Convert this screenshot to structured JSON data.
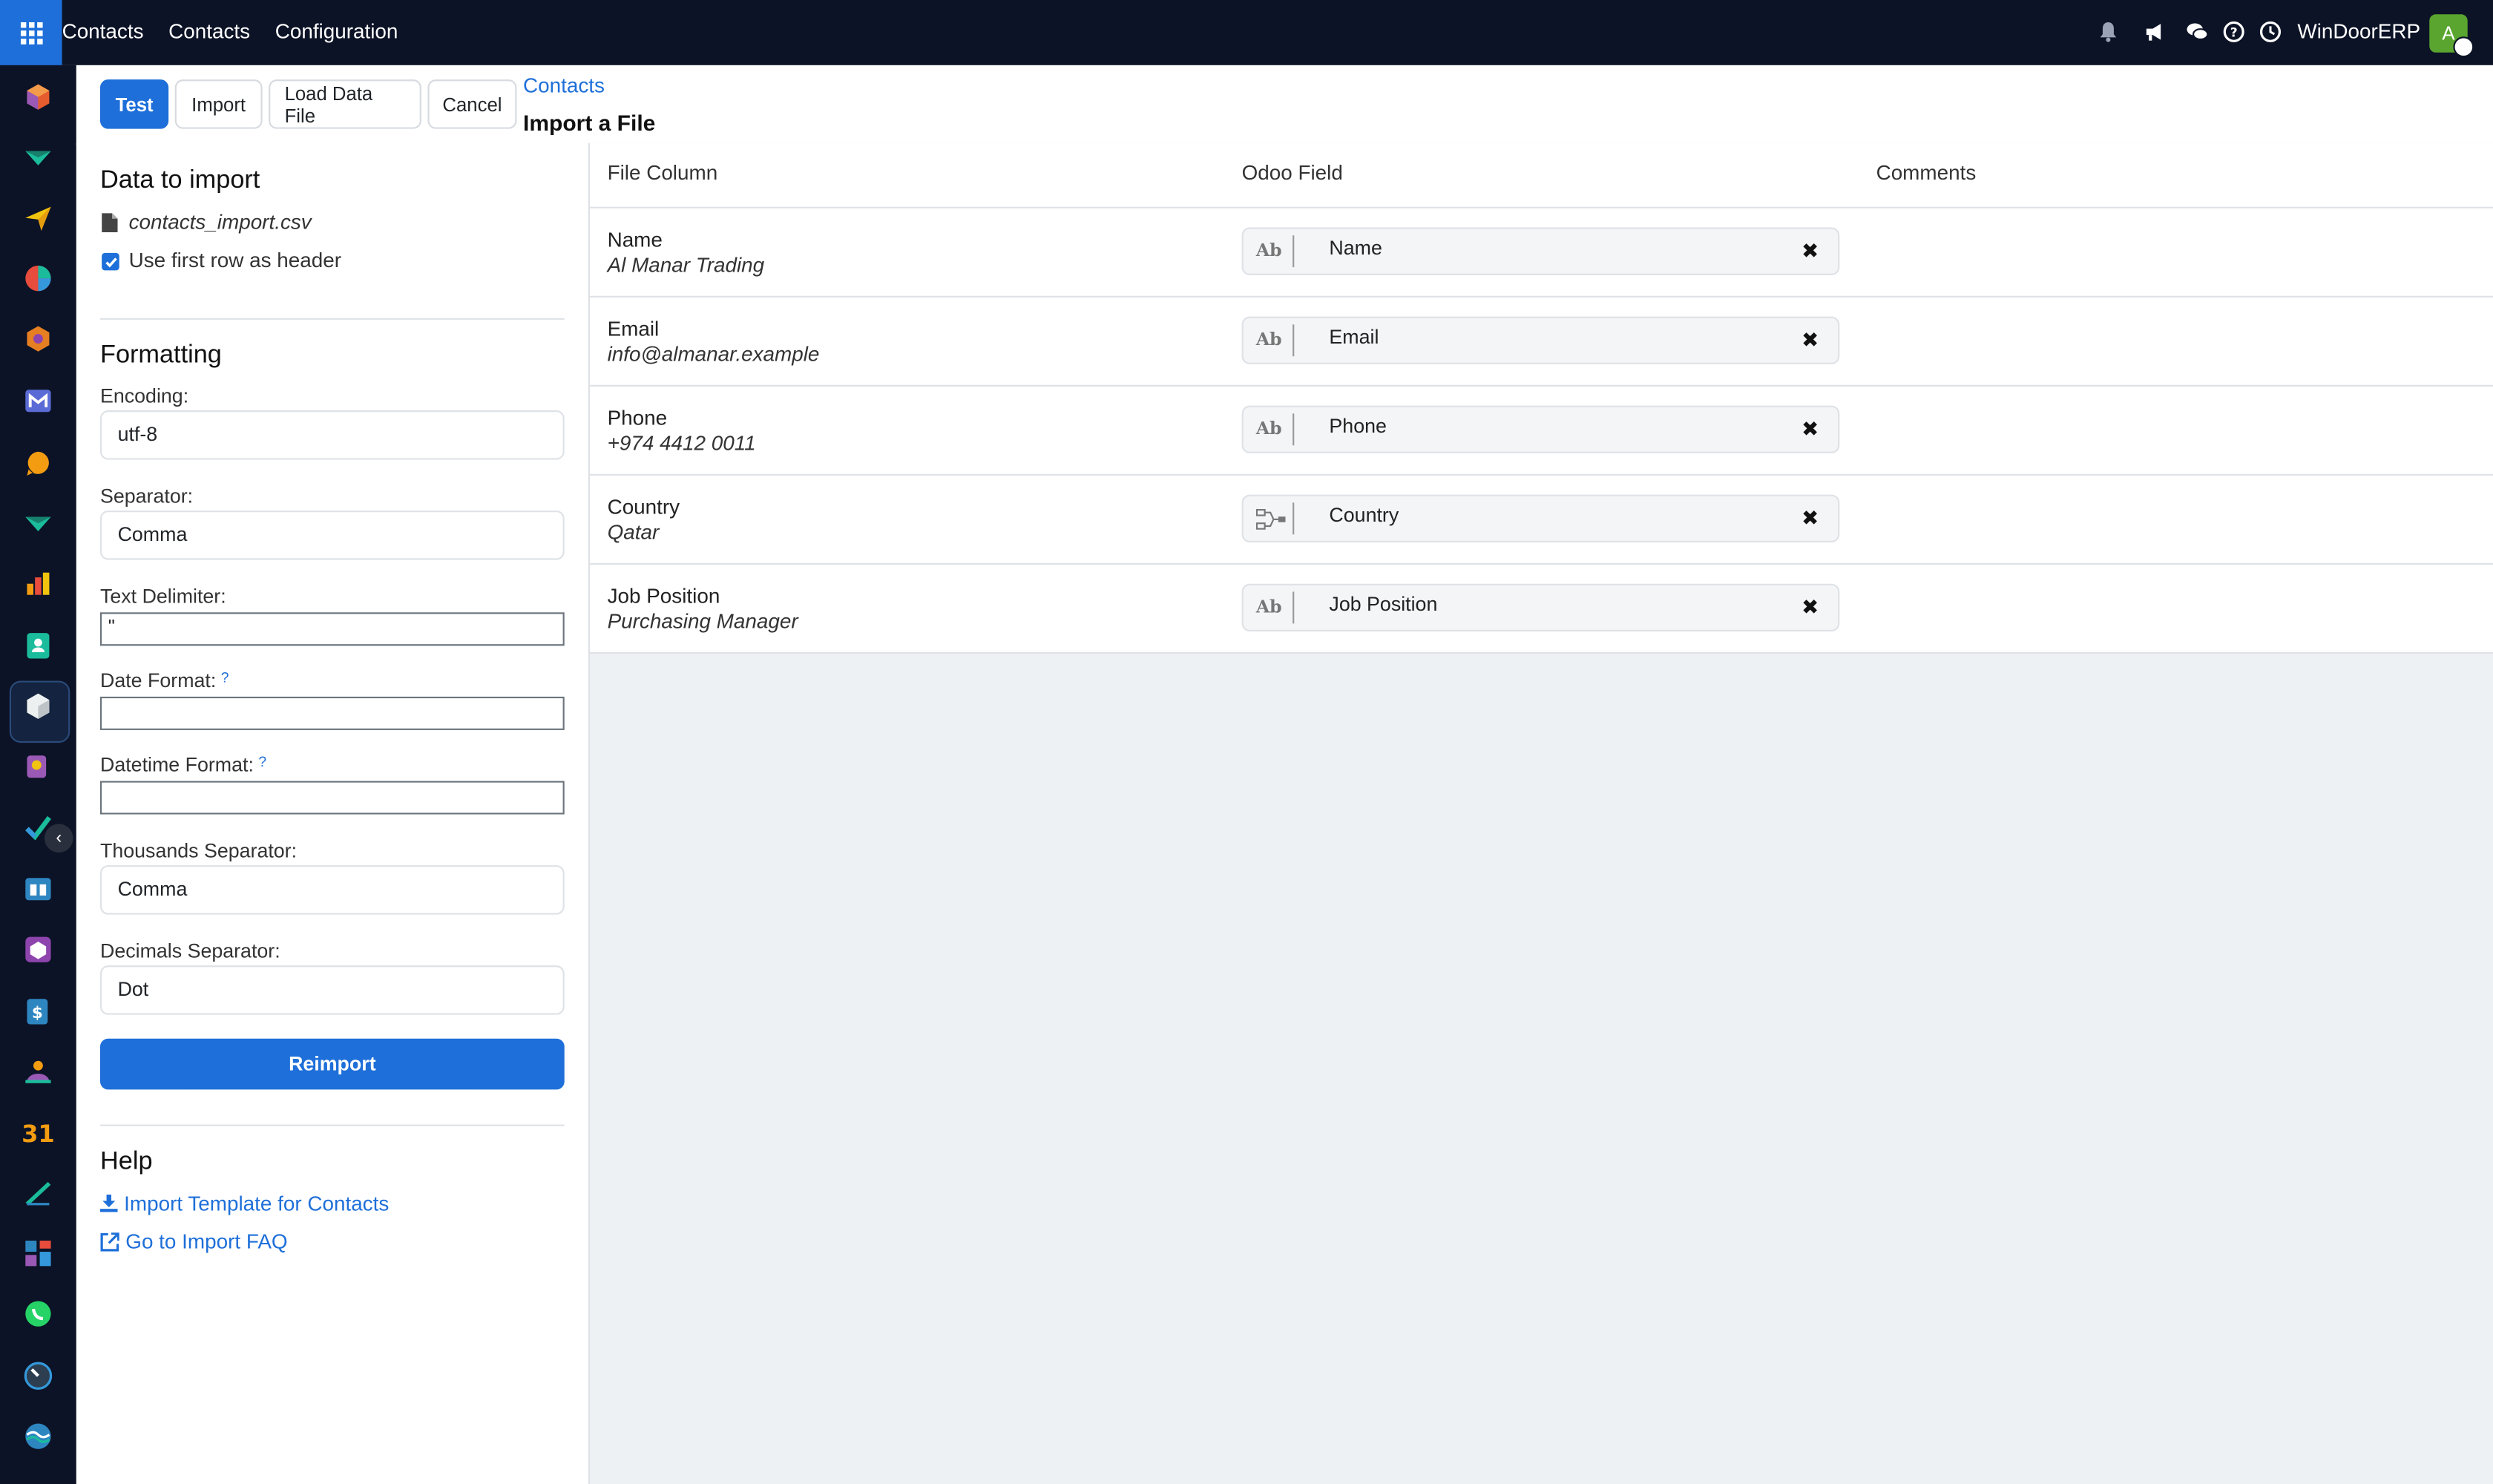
{
  "navbar": {
    "menu": [
      "Contacts",
      "Contacts",
      "Configuration"
    ],
    "company": "WinDoorERP",
    "avatar_initial": "A"
  },
  "control": {
    "buttons": [
      "Test",
      "Import",
      "Load Data File",
      "Cancel"
    ],
    "breadcrumb_parent": "Contacts",
    "breadcrumb_current": "Import a File"
  },
  "sidebar": {
    "data_heading": "Data to import",
    "file_name": "contacts_import.csv",
    "header_checkbox_label": "Use first row as header",
    "header_checkbox_checked": true,
    "formatting_heading": "Formatting",
    "encoding_label": "Encoding:",
    "encoding_value": "utf-8",
    "separator_label": "Separator:",
    "separator_value": "Comma",
    "text_delimiter_label": "Text Delimiter:",
    "text_delimiter_value": "\"",
    "date_format_label": "Date Format:",
    "date_format_value": "",
    "datetime_format_label": "Datetime Format:",
    "datetime_format_value": "",
    "help_marker": "?",
    "thousands_label": "Thousands Separator:",
    "thousands_value": "Comma",
    "decimals_label": "Decimals Separator:",
    "decimals_value": "Dot",
    "reimport_label": "Reimport",
    "help_heading": "Help",
    "help_links": [
      "Import Template for Contacts",
      "Go to Import FAQ"
    ]
  },
  "table": {
    "headers": [
      "File Column",
      "Odoo Field",
      "Comments"
    ],
    "rows": [
      {
        "column": "Name",
        "sample": "Al Manar Trading",
        "field": "Name",
        "field_type": "Ab"
      },
      {
        "column": "Email",
        "sample": "info@almanar.example",
        "field": "Email",
        "field_type": "Ab"
      },
      {
        "column": "Phone",
        "sample": "+974 4412 0011",
        "field": "Phone",
        "field_type": "Ab"
      },
      {
        "column": "Country",
        "sample": "Qatar",
        "field": "Country",
        "field_type": "relation"
      },
      {
        "column": "Job Position",
        "sample": "Purchasing Manager",
        "field": "Job Position",
        "field_type": "Ab"
      }
    ],
    "remove_glyph": "✖"
  },
  "colors": {
    "navbar_bg": "#0c1326",
    "primary": "#1e6fd9",
    "avatar_bg": "#5aa52f"
  }
}
